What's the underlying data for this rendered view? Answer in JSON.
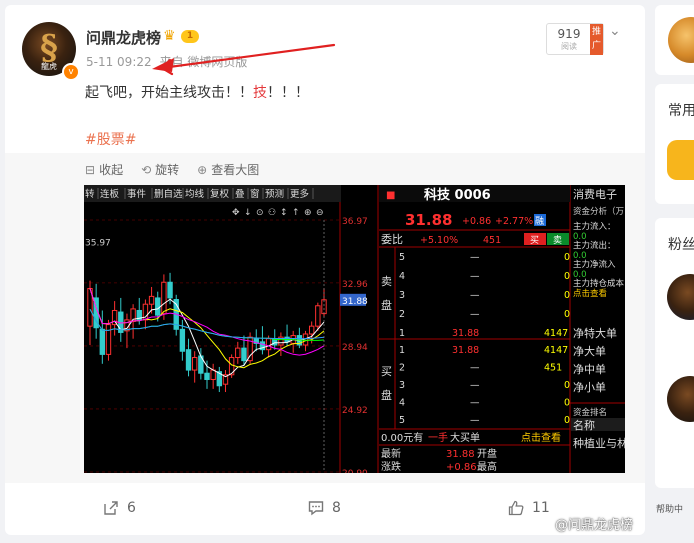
{
  "post": {
    "author": "问鼎龙虎榜",
    "level_badge": "1",
    "vip_badge": "v",
    "avatar_text": "龍虎",
    "timestamp": "5-11 09:22",
    "source_prefix": "来自",
    "source": "微博网页版",
    "read_count": "919",
    "read_label": "阅读",
    "promo_label": "推广",
    "text_before": "起飞吧，开始主线攻击！！",
    "text_red": "技",
    "text_after": "！！！",
    "topic": "#股票#"
  },
  "media_tools": {
    "collapse": "收起",
    "rotate": "旋转",
    "view_large": "查看大图"
  },
  "stock": {
    "tabs": [
      "转",
      "连板",
      "事件",
      "删自选",
      "均线",
      "复权",
      "叠",
      "窗",
      "预测",
      "更多"
    ],
    "name": "科技 0006",
    "price": "31.88",
    "change": "+0.86",
    "change_pct": "+2.77%",
    "tag_rong": "融",
    "weibi_label": "委比",
    "weibi": "+5.10%",
    "weicha": "451",
    "buy_btn": "买",
    "sell_btn": "卖",
    "sell_side_label": [
      "卖",
      "盘"
    ],
    "buy_side_label": [
      "买",
      "盘"
    ],
    "sell_levels": [
      {
        "n": "5",
        "price": "—",
        "vol": "0"
      },
      {
        "n": "4",
        "price": "—",
        "vol": "0"
      },
      {
        "n": "3",
        "price": "—",
        "vol": "0"
      },
      {
        "n": "2",
        "price": "—",
        "vol": "0"
      },
      {
        "n": "1",
        "price": "31.88",
        "vol": "4147"
      }
    ],
    "buy_levels": [
      {
        "n": "1",
        "price": "31.88",
        "vol": "4147"
      },
      {
        "n": "2",
        "price": "—",
        "vol": "451"
      },
      {
        "n": "3",
        "price": "—",
        "vol": "0"
      },
      {
        "n": "4",
        "price": "—",
        "vol": "0"
      },
      {
        "n": "5",
        "price": "—",
        "vol": "0"
      }
    ],
    "big_order_row": {
      "left": "0.00元有",
      "mid": "一手",
      "label": "大买单",
      "link": "点击查看"
    },
    "quote_rows": [
      {
        "k": "最新",
        "v": "31.88",
        "k2": "开盘"
      },
      {
        "k": "涨跌",
        "v": "+0.86",
        "k2": "最高"
      }
    ],
    "y_ticks": [
      "36.97",
      "32.96",
      "31.88",
      "28.94",
      "24.92",
      "20.90"
    ],
    "y_ticks_values": [
      36.97,
      32.96,
      31.88,
      28.94,
      24.92,
      20.9
    ],
    "high_label": "35.97",
    "side_panel": {
      "title": "消费电子",
      "subtitle": "资金分析（万",
      "rows": [
        {
          "k": "主力流入：",
          "v": "0.0"
        },
        {
          "k": "主力流出：",
          "v": "0.0"
        },
        {
          "k": "主力净流入",
          "v": "0.0"
        },
        {
          "k": "主力持仓成本",
          "v": "点击查看"
        }
      ],
      "flows": [
        "净特大单",
        "净大单",
        "净中单",
        "净小单"
      ],
      "rank_title": "资金排名",
      "rank_head": "名称",
      "rank_first": "种植业与林"
    }
  },
  "actions": {
    "repost": "6",
    "comment": "8",
    "like": "11"
  },
  "sidebar": {
    "section1": "常用",
    "section2": "粉丝",
    "help": "帮助中"
  },
  "watermark": "@问鼎龙虎榜",
  "chart_data": {
    "type": "candlestick",
    "title": "",
    "ylim": [
      20.9,
      36.97
    ],
    "candles": [
      {
        "o": 30.2,
        "h": 33.1,
        "l": 29.0,
        "c": 32.6
      },
      {
        "o": 32.0,
        "h": 32.9,
        "l": 29.4,
        "c": 30.1
      },
      {
        "o": 30.0,
        "h": 31.2,
        "l": 27.8,
        "c": 28.4
      },
      {
        "o": 28.4,
        "h": 30.6,
        "l": 28.0,
        "c": 30.3
      },
      {
        "o": 30.3,
        "h": 31.8,
        "l": 29.6,
        "c": 31.2
      },
      {
        "o": 31.1,
        "h": 32.0,
        "l": 29.2,
        "c": 29.8
      },
      {
        "o": 29.9,
        "h": 31.0,
        "l": 28.8,
        "c": 30.6
      },
      {
        "o": 30.5,
        "h": 31.6,
        "l": 29.4,
        "c": 31.3
      },
      {
        "o": 31.2,
        "h": 32.0,
        "l": 30.3,
        "c": 30.6
      },
      {
        "o": 30.6,
        "h": 31.9,
        "l": 30.0,
        "c": 31.6
      },
      {
        "o": 31.6,
        "h": 32.7,
        "l": 31.0,
        "c": 32.1
      },
      {
        "o": 32.0,
        "h": 32.4,
        "l": 30.5,
        "c": 30.9
      },
      {
        "o": 31.0,
        "h": 33.5,
        "l": 30.6,
        "c": 33.0
      },
      {
        "o": 33.0,
        "h": 33.6,
        "l": 31.6,
        "c": 32.0
      },
      {
        "o": 31.9,
        "h": 32.2,
        "l": 29.6,
        "c": 30.0
      },
      {
        "o": 30.0,
        "h": 30.6,
        "l": 28.0,
        "c": 28.6
      },
      {
        "o": 28.7,
        "h": 29.4,
        "l": 27.0,
        "c": 27.4
      },
      {
        "o": 27.4,
        "h": 28.6,
        "l": 26.6,
        "c": 28.2
      },
      {
        "o": 28.3,
        "h": 28.8,
        "l": 26.8,
        "c": 27.2
      },
      {
        "o": 27.2,
        "h": 28.0,
        "l": 26.2,
        "c": 26.8
      },
      {
        "o": 26.8,
        "h": 27.8,
        "l": 26.2,
        "c": 27.4
      },
      {
        "o": 27.3,
        "h": 27.6,
        "l": 26.0,
        "c": 26.4
      },
      {
        "o": 26.5,
        "h": 27.4,
        "l": 26.0,
        "c": 27.1
      },
      {
        "o": 27.1,
        "h": 28.4,
        "l": 26.9,
        "c": 28.2
      },
      {
        "o": 28.2,
        "h": 29.2,
        "l": 27.8,
        "c": 28.8
      },
      {
        "o": 28.8,
        "h": 29.6,
        "l": 27.7,
        "c": 28.0
      },
      {
        "o": 28.0,
        "h": 29.8,
        "l": 27.8,
        "c": 29.5
      },
      {
        "o": 29.4,
        "h": 30.0,
        "l": 28.6,
        "c": 29.1
      },
      {
        "o": 29.2,
        "h": 30.2,
        "l": 28.4,
        "c": 28.7
      },
      {
        "o": 28.7,
        "h": 29.6,
        "l": 28.2,
        "c": 29.4
      },
      {
        "o": 29.4,
        "h": 30.0,
        "l": 28.7,
        "c": 29.0
      },
      {
        "o": 29.0,
        "h": 29.8,
        "l": 28.3,
        "c": 29.5
      },
      {
        "o": 29.5,
        "h": 30.3,
        "l": 28.9,
        "c": 29.2
      },
      {
        "o": 29.1,
        "h": 29.9,
        "l": 28.5,
        "c": 29.6
      },
      {
        "o": 29.6,
        "h": 30.1,
        "l": 28.8,
        "c": 29.0
      },
      {
        "o": 29.0,
        "h": 29.9,
        "l": 28.6,
        "c": 29.7
      },
      {
        "o": 29.7,
        "h": 30.5,
        "l": 29.1,
        "c": 30.2
      },
      {
        "o": 30.2,
        "h": 31.7,
        "l": 29.9,
        "c": 31.5
      },
      {
        "o": 31.0,
        "h": 32.6,
        "l": 30.8,
        "c": 31.88
      }
    ],
    "ma_colors": [
      "#ffffff",
      "#ffff00",
      "#ff00ff",
      "#00ff00",
      "#3399ff"
    ]
  }
}
